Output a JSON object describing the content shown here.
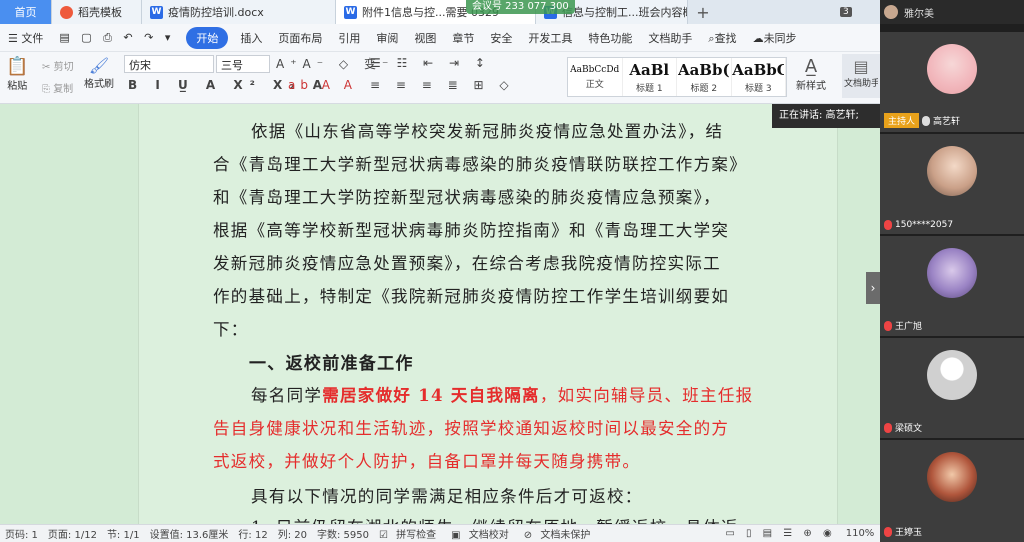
{
  "tabs": [
    {
      "label": "首页"
    },
    {
      "label": "稻壳模板"
    },
    {
      "label": "疫情防控培训.docx"
    },
    {
      "label": "附件1信息与控...需要 0329"
    },
    {
      "label": "信息与控制工...班会内容概要"
    }
  ],
  "meeting_banner": "会议号 233 077 300",
  "window_count": "3",
  "user_name": "雅尔美",
  "menu": {
    "file": "文件",
    "items": [
      "开始",
      "插入",
      "页面布局",
      "引用",
      "审阅",
      "视图",
      "章节",
      "安全",
      "开发工具",
      "特色功能",
      "文档助手"
    ],
    "search": "查找",
    "sync": "未同步"
  },
  "ribbon": {
    "paste": "粘贴",
    "cut": "剪切",
    "copy": "复制",
    "format_painter": "格式刷",
    "font_name": "仿宋",
    "font_size": "三号",
    "styles": [
      {
        "preview": "AaBbCcDd",
        "name": "正文"
      },
      {
        "preview": "AaBl",
        "name": "标题 1"
      },
      {
        "preview": "AaBb(",
        "name": "标题 2"
      },
      {
        "preview": "AaBbC",
        "name": "标题 3"
      }
    ],
    "new_style": "新样式",
    "doc_helper": "文档助手"
  },
  "document": {
    "lines": [
      "依据《山东省高等学校突发新冠肺炎疫情应急处置办法》，结",
      "合《青岛理工大学新型冠状病毒感染的肺炎疫情联防联控工作方案》",
      "和《青岛理工大学防控新型冠状病毒感染的肺炎疫情应急预案》，",
      "根据《高等学校新型冠状病毒肺炎防控指南》和《青岛理工大学突",
      "发新冠肺炎疫情应急处置预案》，在综合考虑我院疫情防控实际工",
      "作的基础上，特制定《我院新冠肺炎疫情防控工作学生培训纲要如",
      "下："
    ],
    "heading": "一、返校前准备工作",
    "para2_start": "每名同学",
    "para2_bold_red": "需居家做好 14 天自我隔离",
    "para2_rest1": "，如实向辅导员、班主任报",
    "para2_line2": "告自身健康状况和生活轨迹，按照学校通知返校时间以最安全的方",
    "para2_line3": "式返校，并做好个人防护，自备口罩并每天随身携带。",
    "para3": "具有以下情况的同学需满足相应条件后才可返校：",
    "para4_partial": "1. 目前仍留在湖北的师生，继续留在原地，暂缓返校，具体返"
  },
  "speaking": "正在讲话: 高艺轩;",
  "participants": [
    {
      "name": "高艺轩",
      "role": "主持人"
    },
    {
      "name": "150****2057"
    },
    {
      "name": "王广旭"
    },
    {
      "name": "梁硕文"
    },
    {
      "name": "王婷玉"
    }
  ],
  "status": {
    "page_code": "页码: 1",
    "page": "页面: 1/12",
    "section": "节: 1/1",
    "setting": "设置值: 13.6厘米",
    "row": "行: 12",
    "col": "列: 20",
    "words": "字数: 5950",
    "spell": "拼写检查",
    "proof": "文档校对",
    "protect": "文档未保护",
    "zoom": "110%"
  }
}
